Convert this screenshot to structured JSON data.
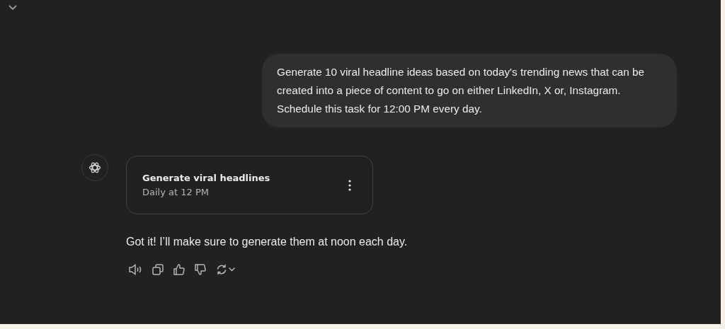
{
  "user_message": "Generate 10 viral headline ideas based on today's trending news that can be created into a piece of content to go on either LinkedIn, X or, Instagram. Schedule this task for 12:00 PM every day.",
  "task_card": {
    "title": "Generate viral headlines",
    "schedule": "Daily at 12 PM"
  },
  "assistant_message": "Got it! I’ll make sure to generate them at noon each day."
}
